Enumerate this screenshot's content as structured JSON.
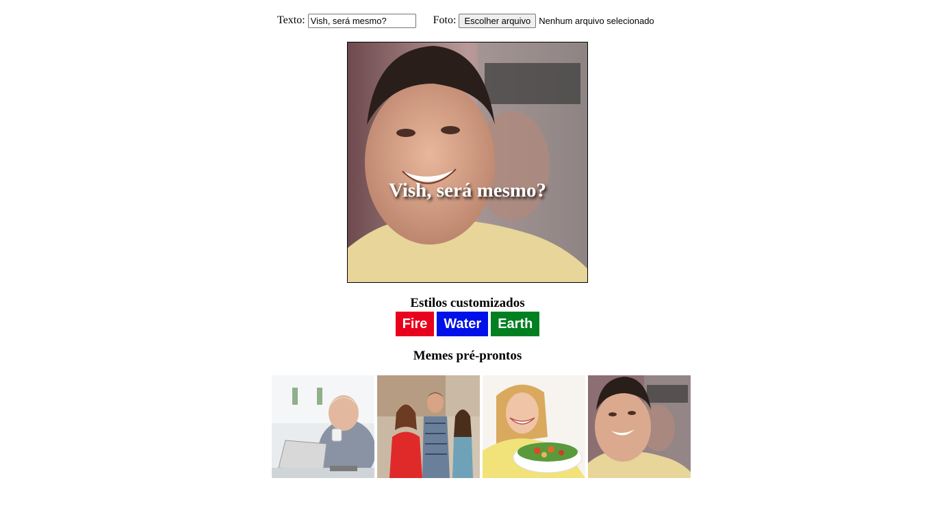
{
  "controls": {
    "text_label": "Texto:",
    "text_value": "Vish, será mesmo?",
    "photo_label": "Foto:",
    "file_button_label": "Escolher arquivo",
    "file_status": "Nenhum arquivo selecionado"
  },
  "meme": {
    "caption": "Vish, será mesmo?",
    "image": "smiling-man-photo"
  },
  "styles": {
    "title": "Estilos customizados",
    "buttons": [
      {
        "label": "Fire",
        "color": "#e8001c"
      },
      {
        "label": "Water",
        "color": "#0010e8"
      },
      {
        "label": "Earth",
        "color": "#008020"
      }
    ]
  },
  "premade": {
    "title": "Memes pré-prontos",
    "items": [
      {
        "image": "old-man-laptop-photo"
      },
      {
        "image": "distracted-boyfriend-photo"
      },
      {
        "image": "woman-eating-salad-photo"
      },
      {
        "image": "smiling-man-photo"
      }
    ]
  }
}
